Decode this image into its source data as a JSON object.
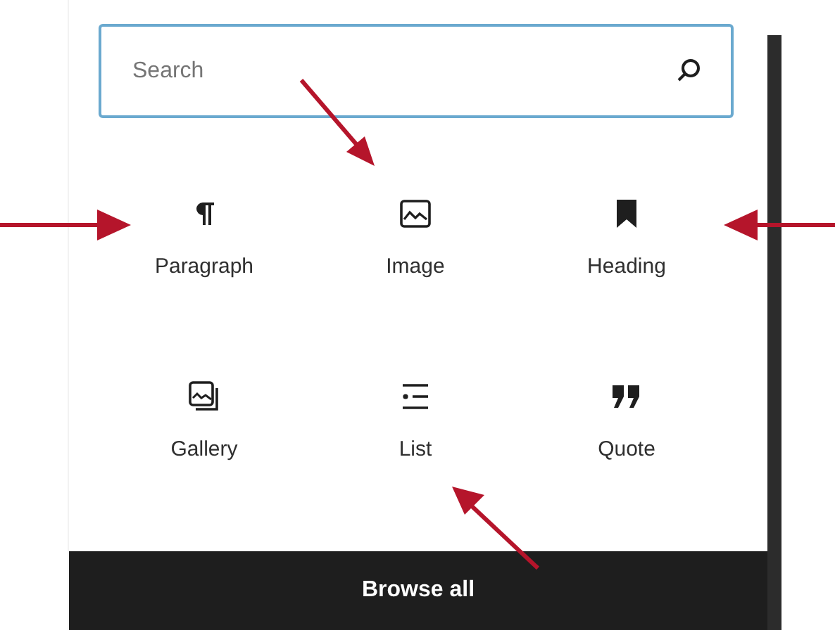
{
  "search": {
    "placeholder": "Search"
  },
  "blocks": [
    {
      "label": "Paragraph"
    },
    {
      "label": "Image"
    },
    {
      "label": "Heading"
    },
    {
      "label": "Gallery"
    },
    {
      "label": "List"
    },
    {
      "label": "Quote"
    }
  ],
  "browse_button": "Browse all"
}
